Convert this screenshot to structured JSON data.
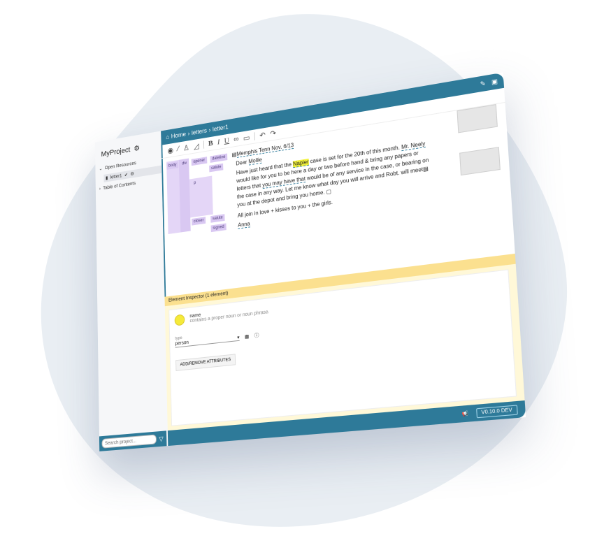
{
  "sidebar": {
    "project_name": "MyProject",
    "open_resources_label": "Open Resources",
    "resource_item": "letter1",
    "toc_label": "Table of Contents",
    "search_placeholder": "Search project..."
  },
  "topbar": {
    "crumbs": [
      "Home",
      "letters",
      "letter1"
    ]
  },
  "toolbar": {
    "bold": "B",
    "italic": "I",
    "underline": "U",
    "undo": "↶",
    "redo": "↷"
  },
  "editor": {
    "tags": {
      "body": "body",
      "div": "div",
      "opener": "opener",
      "dateline": "dateline",
      "salute": "salute",
      "p": "p",
      "closer": "closer",
      "salute2": "salute",
      "signed": "signed"
    },
    "lines": {
      "dateline": "Memphis Tenn Nov. 6/13",
      "salute_pre": "Dear ",
      "salute_name": "Mollie",
      "p1_pre": "Have just heard that the ",
      "p1_hl": "Napier",
      "p1_post": " case is set for the 20th of this month. ",
      "p1_name": "Mr. Neely",
      "p2": "would like for you to be here a day or two before hand & bring any papers or",
      "p3_pre": "letters that ",
      "p3_ul": "you may have that",
      "p3_post": " would be of any service in the case, or bearing on",
      "p4": "the case in any way. Let me know what day you will arrive and Robt. will meet",
      "p5": "you at the depot and bring you home.",
      "closer_salute": "All join in love + kisses to you + the girls.",
      "signed": "Anna"
    }
  },
  "inspector": {
    "title": "Element Inspector (1 element)",
    "element_name": "name",
    "element_desc": "contains a proper noun or noun phrase.",
    "type_label": "type",
    "type_value": "person",
    "add_remove_label": "ADD/REMOVE ATTRIBUTES"
  },
  "bottombar": {
    "version": "V0.10.0 DEV"
  },
  "colors": {
    "brand": "#2e7a99",
    "tag": "#d9c8f2",
    "inspector_header": "#fbe08f",
    "highlight": "#f2f23a"
  }
}
